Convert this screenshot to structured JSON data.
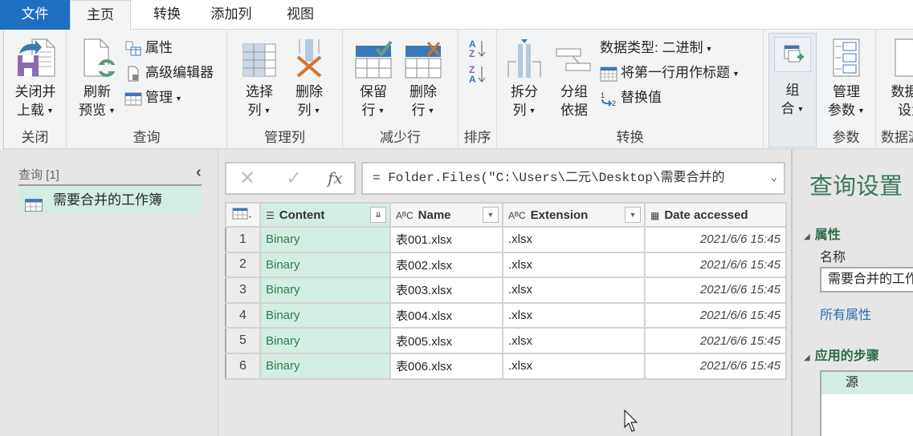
{
  "tabs": [
    {
      "label": "文件"
    },
    {
      "label": "主页",
      "active": true
    },
    {
      "label": "转换"
    },
    {
      "label": "添加列"
    },
    {
      "label": "视图"
    }
  ],
  "ribbon": {
    "close": {
      "group": "关闭",
      "close_load": [
        "关闭并",
        "上载"
      ]
    },
    "query": {
      "group": "查询",
      "refresh": [
        "刷新",
        "预览"
      ],
      "properties": "属性",
      "advanced_editor": "高级编辑器",
      "manage": "管理"
    },
    "manage_cols": {
      "group": "管理列",
      "choose": [
        "选择",
        "列"
      ],
      "remove": [
        "删除",
        "列"
      ]
    },
    "reduce_rows": {
      "group": "减少行",
      "keep": [
        "保留",
        "行"
      ],
      "remove": [
        "删除",
        "行"
      ]
    },
    "sort": {
      "group": "排序"
    },
    "transform": {
      "group": "转换",
      "split": [
        "拆分",
        "列"
      ],
      "group_by": [
        "分组",
        "依据"
      ],
      "data_type": "数据类型: 二进制",
      "first_row_header": "将第一行用作标题",
      "replace_values": "替换值"
    },
    "combine": {
      "label": [
        "组",
        "合"
      ]
    },
    "params": {
      "group": "参数",
      "manage": [
        "管理",
        "参数"
      ]
    },
    "datasource": {
      "group": "数据源",
      "settings": [
        "数据源",
        "设置"
      ]
    }
  },
  "queries": {
    "header": "查询 [1]",
    "items": [
      {
        "label": "需要合并的工作簿"
      }
    ]
  },
  "formula": {
    "text": "= Folder.Files(\"C:\\Users\\二元\\Desktop\\需要合并的"
  },
  "grid": {
    "columns": [
      {
        "name": "Content",
        "type": "binary"
      },
      {
        "name": "Name",
        "type": "ABC"
      },
      {
        "name": "Extension",
        "type": "ABC"
      },
      {
        "name": "Date accessed",
        "type": "datetime"
      }
    ],
    "rows": [
      {
        "n": "1",
        "content": "Binary",
        "name": "表001.xlsx",
        "ext": ".xlsx",
        "date": "2021/6/6 15:45"
      },
      {
        "n": "2",
        "content": "Binary",
        "name": "表002.xlsx",
        "ext": ".xlsx",
        "date": "2021/6/6 15:45"
      },
      {
        "n": "3",
        "content": "Binary",
        "name": "表003.xlsx",
        "ext": ".xlsx",
        "date": "2021/6/6 15:45"
      },
      {
        "n": "4",
        "content": "Binary",
        "name": "表004.xlsx",
        "ext": ".xlsx",
        "date": "2021/6/6 15:45"
      },
      {
        "n": "5",
        "content": "Binary",
        "name": "表005.xlsx",
        "ext": ".xlsx",
        "date": "2021/6/6 15:45"
      },
      {
        "n": "6",
        "content": "Binary",
        "name": "表006.xlsx",
        "ext": ".xlsx",
        "date": "2021/6/6 15:45"
      }
    ]
  },
  "settings": {
    "title": "查询设置",
    "properties": "属性",
    "name_label": "名称",
    "name_value": "需要合并的工作簿",
    "all_properties": "所有属性",
    "applied_steps": "应用的步骤",
    "steps": [
      {
        "label": "源"
      }
    ]
  }
}
